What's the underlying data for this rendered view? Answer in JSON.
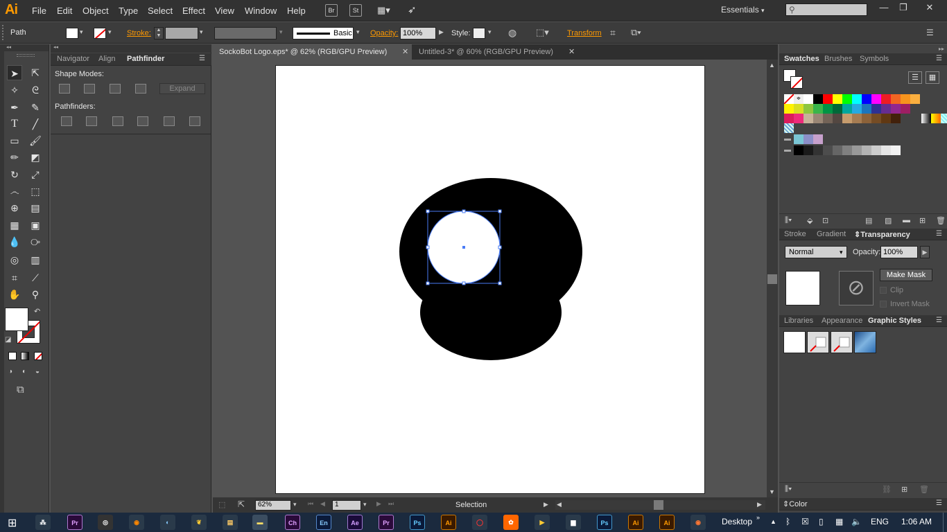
{
  "app": {
    "logo": "Ai",
    "workspace": "Essentials"
  },
  "menu": [
    "File",
    "Edit",
    "Object",
    "Type",
    "Select",
    "Effect",
    "View",
    "Window",
    "Help"
  ],
  "menu_icons": {
    "bridge": "Br",
    "stock": "St"
  },
  "control": {
    "object_type": "Path",
    "stroke_label": "Stroke:",
    "stroke_profile": "Basic",
    "opacity_label": "Opacity:",
    "opacity_value": "100%",
    "style_label": "Style:",
    "transform_label": "Transform"
  },
  "left_panel": {
    "tabs": [
      "Navigator",
      "Align",
      "Pathfinder"
    ],
    "shape_modes_label": "Shape Modes:",
    "expand_label": "Expand",
    "pathfinders_label": "Pathfinders:"
  },
  "documents": [
    {
      "title": "SockoBot Logo.eps* @ 62% (RGB/GPU Preview)",
      "active": true
    },
    {
      "title": "Untitled-3* @ 60% (RGB/GPU Preview)",
      "active": false
    }
  ],
  "status": {
    "zoom": "62%",
    "artboard": "1",
    "tool": "Selection"
  },
  "swatches_panel": {
    "tabs": [
      "Swatches",
      "Brushes",
      "Symbols"
    ]
  },
  "transparency_panel": {
    "tabs": [
      "Stroke",
      "Gradient",
      "Transparency"
    ],
    "blend_mode": "Normal",
    "opacity_label": "Opacity:",
    "opacity_value": "100%",
    "make_mask_label": "Make Mask",
    "clip_label": "Clip",
    "invert_mask_label": "Invert Mask"
  },
  "graphic_styles_panel": {
    "tabs": [
      "Libraries",
      "Appearance",
      "Graphic Styles"
    ]
  },
  "color_panel": {
    "label": "Color"
  },
  "taskbar": {
    "apps": [
      "Pr",
      "Ch",
      "En",
      "Ae",
      "Pr",
      "Ps",
      "Ai",
      "Ps",
      "Ai",
      "Ai"
    ],
    "desktop_label": "Desktop",
    "lang": "ENG",
    "time": "1:06 AM"
  },
  "swatch_colors": {
    "row1": [
      "#ffffff",
      "#000000",
      "#ff0000",
      "#ffff00",
      "#00ff00",
      "#00ffff",
      "#0000ff",
      "#ff00ff",
      "#ed1c24",
      "#f26522",
      "#f7941d",
      "#fbaf3f"
    ],
    "row2": [
      "#fff200",
      "#d7df23",
      "#8dc63f",
      "#39b54a",
      "#009444",
      "#006838",
      "#00a79d",
      "#27aae1",
      "#1c75bc",
      "#2e3192",
      "#662d91",
      "#92278f",
      "#9e1f63"
    ],
    "row3": [
      "#da1c5c",
      "#ee2a7b",
      "#c7b299",
      "#998675",
      "#736357",
      "#534741",
      "#c69c6d",
      "#a67c52",
      "#8c6239",
      "#754c24",
      "#603813",
      "#42210b"
    ],
    "row4": [
      "#7ac6d5",
      "#8c8fc8",
      "#c7a0cc"
    ],
    "row5": [
      "#000000",
      "#1a1a1a",
      "#333333",
      "#4d4d4d",
      "#666666",
      "#808080",
      "#999999",
      "#b3b3b3",
      "#cccccc",
      "#e6e6e6",
      "#f2f2f2"
    ]
  }
}
